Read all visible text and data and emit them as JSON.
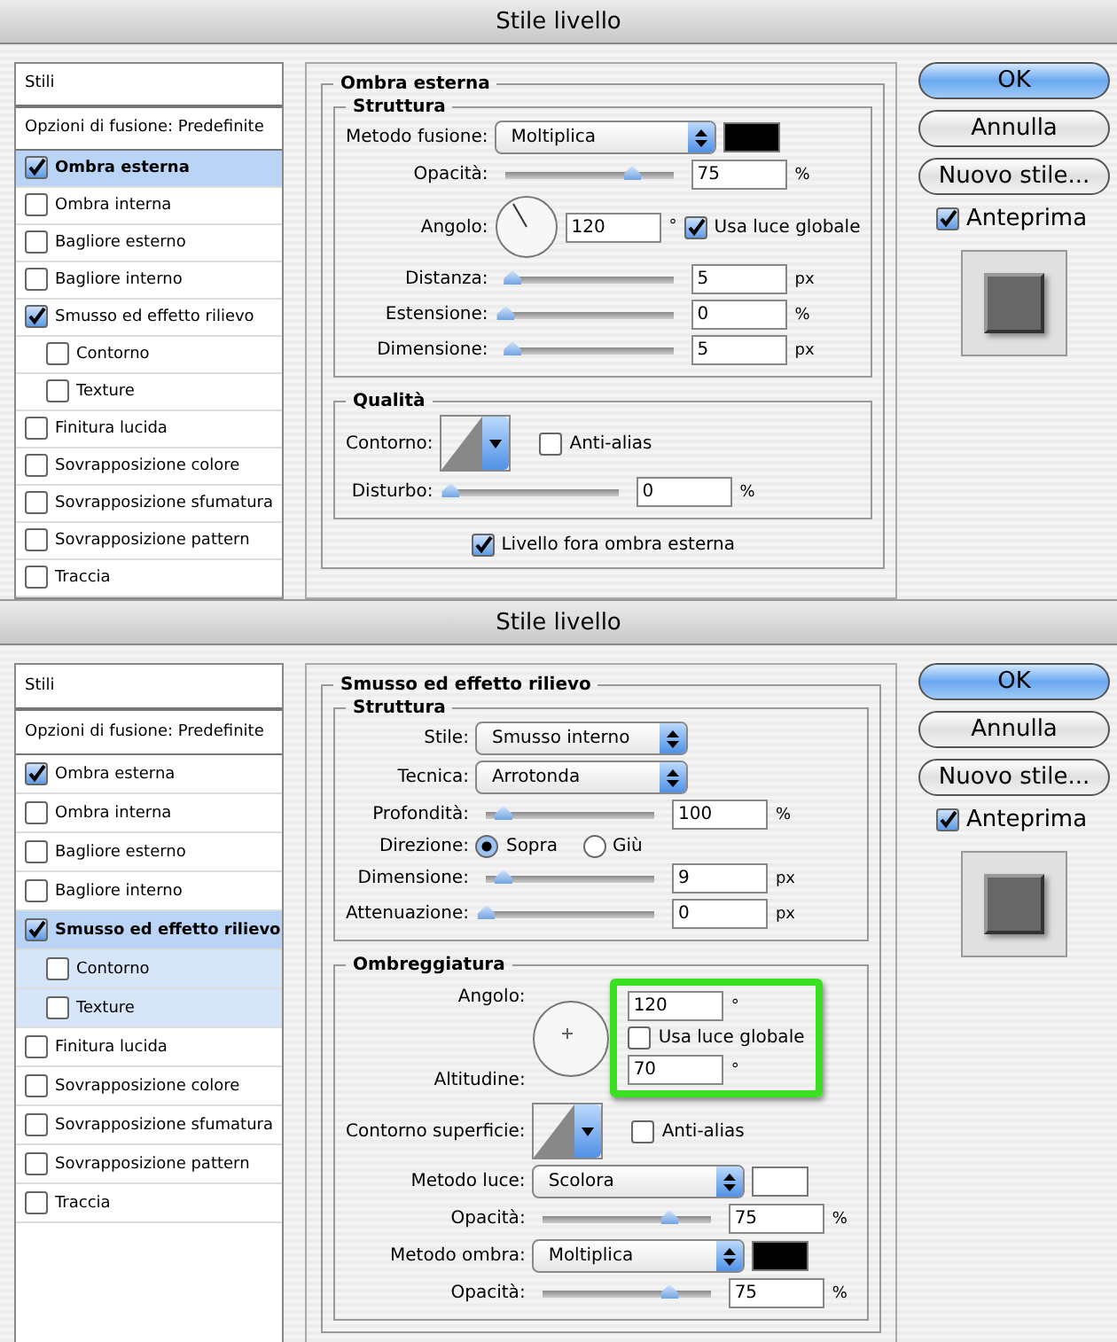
{
  "dialogs": [
    {
      "title": "Stile livello",
      "sidebar": {
        "header": "Stili",
        "blending": "Opzioni di fusione: Predefinite",
        "items": [
          {
            "label": "Ombra esterna",
            "checked": true,
            "selected": true
          },
          {
            "label": "Ombra interna",
            "checked": false,
            "selected": false
          },
          {
            "label": "Bagliore esterno",
            "checked": false,
            "selected": false
          },
          {
            "label": "Bagliore interno",
            "checked": false,
            "selected": false
          },
          {
            "label": "Smusso ed effetto rilievo",
            "checked": true,
            "selected": false,
            "children": [
              {
                "label": "Contorno",
                "checked": false,
                "selected": false
              },
              {
                "label": "Texture",
                "checked": false,
                "selected": false
              }
            ]
          },
          {
            "label": "Finitura lucida",
            "checked": false,
            "selected": false
          },
          {
            "label": "Sovrapposizione colore",
            "checked": false,
            "selected": false
          },
          {
            "label": "Sovrapposizione sfumatura",
            "checked": false,
            "selected": false
          },
          {
            "label": "Sovrapposizione pattern",
            "checked": false,
            "selected": false
          },
          {
            "label": "Traccia",
            "checked": false,
            "selected": false
          }
        ]
      },
      "panel": {
        "title": "Ombra esterna",
        "groups": [
          {
            "title": "Struttura",
            "rows": [
              {
                "kind": "select",
                "label": "Metodo fusione:",
                "value": "Moltiplica",
                "color": "#000000"
              },
              {
                "kind": "slider",
                "label": "Opacità:",
                "level": 0.75,
                "value": "75",
                "unit": "%"
              },
              {
                "kind": "angle",
                "label": "Angolo:",
                "value": "120",
                "unit": "°",
                "check": "Usa luce globale",
                "checked": true
              },
              {
                "kind": "slider",
                "label": "Distanza:",
                "level": 0.04,
                "value": "5",
                "unit": "px"
              },
              {
                "kind": "slider",
                "label": "Estensione:",
                "level": 0,
                "value": "0",
                "unit": "%"
              },
              {
                "kind": "slider",
                "label": "Dimensione:",
                "level": 0.04,
                "value": "5",
                "unit": "px"
              }
            ]
          },
          {
            "title": "Qualità",
            "rows": [
              {
                "kind": "contour",
                "label": "Contorno:",
                "check": "Anti-alias",
                "checked": false
              },
              {
                "kind": "slider",
                "label": "Disturbo:",
                "level": 0,
                "value": "0",
                "unit": "%"
              }
            ]
          }
        ],
        "footer": {
          "label": "Livello fora ombra esterna",
          "checked": true
        }
      },
      "buttons": [
        {
          "label": "OK",
          "default": true
        },
        {
          "label": "Annulla",
          "default": false
        },
        {
          "label": "Nuovo stile...",
          "default": false
        }
      ],
      "preview": {
        "label": "Anteprima",
        "checked": true
      }
    },
    {
      "title": "Stile livello",
      "sidebar": {
        "header": "Stili",
        "blending": "Opzioni di fusione: Predefinite",
        "items": [
          {
            "label": "Ombra esterna",
            "checked": true,
            "selected": false
          },
          {
            "label": "Ombra interna",
            "checked": false,
            "selected": false
          },
          {
            "label": "Bagliore esterno",
            "checked": false,
            "selected": false
          },
          {
            "label": "Bagliore interno",
            "checked": false,
            "selected": false
          },
          {
            "label": "Smusso ed effetto rilievo",
            "checked": true,
            "selected": true,
            "children": [
              {
                "label": "Contorno",
                "checked": false,
                "selected": false
              },
              {
                "label": "Texture",
                "checked": false,
                "selected": false
              }
            ]
          },
          {
            "label": "Finitura lucida",
            "checked": false,
            "selected": false
          },
          {
            "label": "Sovrapposizione colore",
            "checked": false,
            "selected": false
          },
          {
            "label": "Sovrapposizione sfumatura",
            "checked": false,
            "selected": false
          },
          {
            "label": "Sovrapposizione pattern",
            "checked": false,
            "selected": false
          },
          {
            "label": "Traccia",
            "checked": false,
            "selected": false
          }
        ]
      },
      "panel": {
        "title": "Smusso ed effetto rilievo",
        "groups": [
          {
            "title": "Struttura",
            "rows": [
              {
                "kind": "select",
                "label": "Stile:",
                "value": "Smusso interno"
              },
              {
                "kind": "select",
                "label": "Tecnica:",
                "value": "Arrotonda"
              },
              {
                "kind": "slider",
                "label": "Profondità:",
                "level": 0.1,
                "value": "100",
                "unit": "%"
              },
              {
                "kind": "radio",
                "label": "Direzione:",
                "options": [
                  {
                    "label": "Sopra",
                    "selected": true
                  },
                  {
                    "label": "Giù",
                    "selected": false
                  }
                ]
              },
              {
                "kind": "slider",
                "label": "Dimensione:",
                "level": 0.1,
                "value": "9",
                "unit": "px"
              },
              {
                "kind": "slider",
                "label": "Attenuazione:",
                "level": 0,
                "value": "0",
                "unit": "px"
              }
            ]
          },
          {
            "title": "Ombreggiatura",
            "rows": [
              {
                "kind": "shading",
                "angle_label": "Angolo:",
                "altitude_label": "Altitudine:",
                "angle": "120",
                "altitude": "70",
                "unit": "°",
                "check": "Usa luce globale",
                "checked": false,
                "highlighted": true
              },
              {
                "kind": "contour",
                "label": "Contorno superficie:",
                "check": "Anti-alias",
                "checked": false
              },
              {
                "kind": "select",
                "label": "Metodo luce:",
                "value": "Scolora",
                "color": "#ffffff"
              },
              {
                "kind": "slider",
                "label": "Opacità:",
                "level": 0.75,
                "value": "75",
                "unit": "%"
              },
              {
                "kind": "select",
                "label": "Metodo ombra:",
                "value": "Moltiplica",
                "color": "#000000"
              },
              {
                "kind": "slider",
                "label": "Opacità:",
                "level": 0.75,
                "value": "75",
                "unit": "%"
              }
            ]
          }
        ]
      },
      "buttons": [
        {
          "label": "OK",
          "default": true
        },
        {
          "label": "Annulla",
          "default": false
        },
        {
          "label": "Nuovo stile...",
          "default": false
        }
      ],
      "preview": {
        "label": "Anteprima",
        "checked": true
      }
    }
  ]
}
